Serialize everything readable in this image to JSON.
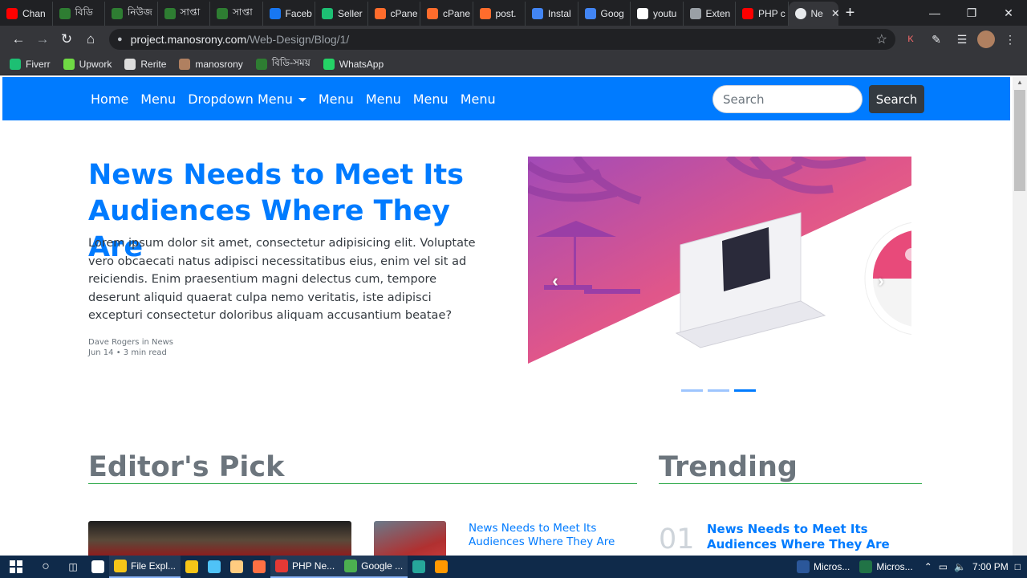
{
  "browser": {
    "tabs": [
      {
        "label": "Chan",
        "color": "#ff0000",
        "icon": "youtube-icon"
      },
      {
        "label": "বিডি",
        "color": "#2e7d32",
        "icon": "bs-icon"
      },
      {
        "label": "নিউজ",
        "color": "#2e7d32",
        "icon": "bs-icon"
      },
      {
        "label": "সাপ্তা",
        "color": "#2e7d32",
        "icon": "bs-icon"
      },
      {
        "label": "সাপ্তা",
        "color": "#2e7d32",
        "icon": "bs-icon"
      },
      {
        "label": "Faceb",
        "color": "#1877f2",
        "icon": "facebook-icon"
      },
      {
        "label": "Seller",
        "color": "#1dbf73",
        "icon": "fiverr-icon"
      },
      {
        "label": "cPane",
        "color": "#ff6c2c",
        "icon": "cpanel-icon"
      },
      {
        "label": "cPane",
        "color": "#ff6c2c",
        "icon": "cpanel-icon"
      },
      {
        "label": "post.",
        "color": "#ff6c2c",
        "icon": "cpanel-icon"
      },
      {
        "label": "Instal",
        "color": "#4285f4",
        "icon": "c-icon"
      },
      {
        "label": "Goog",
        "color": "#4285f4",
        "icon": "translate-icon"
      },
      {
        "label": "youtu",
        "color": "#ffffff",
        "icon": "google-icon"
      },
      {
        "label": "Exten",
        "color": "#9aa0a6",
        "icon": "puzzle-icon"
      },
      {
        "label": "PHP c",
        "color": "#ff0000",
        "icon": "youtube-icon"
      }
    ],
    "active_tab": {
      "label": "Ne",
      "close": "✕"
    },
    "new_tab": "+",
    "url_host": "project.manosrony.com",
    "url_path": "/Web-Design/Blog/1/",
    "bookmarks": [
      {
        "label": "Fiverr",
        "color": "#1dbf73"
      },
      {
        "label": "Upwork",
        "color": "#6fda44"
      },
      {
        "label": "Rerite",
        "color": "#dddddd"
      },
      {
        "label": "manosrony",
        "color": "#b08060"
      },
      {
        "label": "বিডি-সময়",
        "color": "#2e7d32"
      },
      {
        "label": "WhatsApp",
        "color": "#25d366"
      }
    ]
  },
  "site": {
    "nav": {
      "home": "Home",
      "menu1": "Menu",
      "dropdown": "Dropdown Menu",
      "menu2": "Menu",
      "menu3": "Menu",
      "menu4": "Menu",
      "menu5": "Menu"
    },
    "search": {
      "placeholder": "Search",
      "button": "Search"
    },
    "hero": {
      "title": "News Needs to Meet Its Audiences Where They Are",
      "text": "Lorem ipsum dolor sit amet, consectetur adipisicing elit. Voluptate vero obcaecati natus adipisci necessitatibus eius, enim vel sit ad reiciendis. Enim praesentium magni delectus cum, tempore deserunt aliquid quaerat culpa nemo veritatis, iste adipisci excepturi consectetur doloribus aliquam accusantium beatae?",
      "author": "Dave Rogers in News",
      "date": "Jun 14 • 3 min read"
    },
    "carousel": {
      "prev": "‹",
      "next": "›",
      "slides": 3,
      "active_slide": 3
    },
    "editors_pick": {
      "title": "Editor's Pick",
      "side_link": "News Needs to Meet Its Audiences Where They Are"
    },
    "trending": {
      "title": "Trending",
      "items": [
        {
          "num": "01",
          "title": "News Needs to Meet Its Audiences Where They Are"
        }
      ]
    }
  },
  "taskbar": {
    "items": [
      {
        "label": "",
        "color": "#ffffff"
      },
      {
        "label": "File Expl...",
        "color": "#f5c518",
        "open": true
      },
      {
        "label": "",
        "color": "#f5c518"
      },
      {
        "label": "",
        "color": "#4fc3f7"
      },
      {
        "label": "",
        "color": "#ffcc80"
      },
      {
        "label": "",
        "color": "#ff7043"
      },
      {
        "label": "PHP Ne...",
        "color": "#e53935",
        "open": true
      },
      {
        "label": "Google ...",
        "color": "#4caf50",
        "open": true
      },
      {
        "label": "",
        "color": "#26a69a"
      },
      {
        "label": "",
        "color": "#ff9800"
      }
    ],
    "right_items": [
      {
        "label": "Micros...",
        "color": "#2b579a"
      },
      {
        "label": "Micros...",
        "color": "#217346"
      }
    ],
    "time": "7:00 PM"
  }
}
